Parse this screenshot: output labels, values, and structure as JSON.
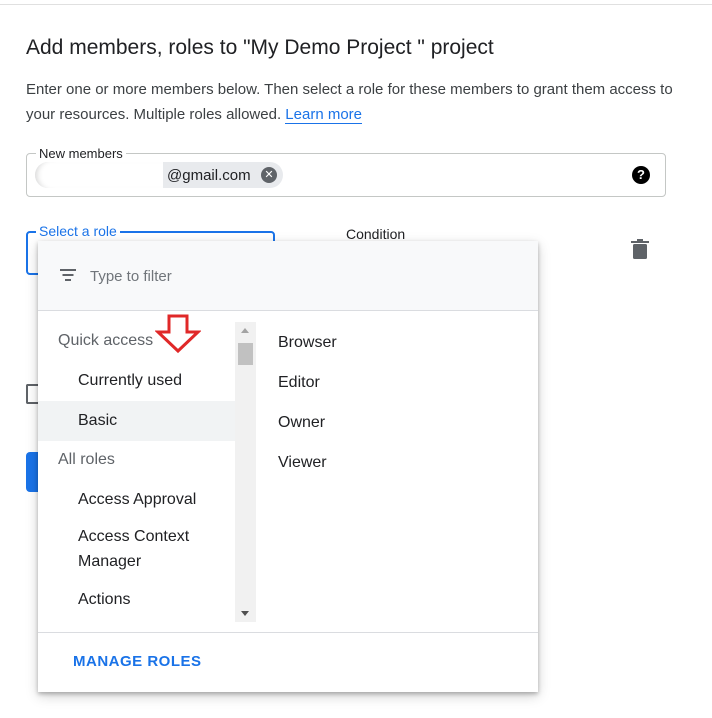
{
  "header": {
    "title": "Add members, roles to \"My Demo Project \" project",
    "description": "Enter one or more members below. Then select a role for these members to grant them access to your resources. Multiple roles allowed.",
    "learn_more": "Learn more"
  },
  "members": {
    "label": "New members",
    "chip_text": "@gmail.com"
  },
  "role": {
    "label": "Select a role"
  },
  "condition": {
    "label": "Condition"
  },
  "dropdown": {
    "filter_placeholder": "Type to filter",
    "left_items": [
      {
        "label": "Quick access",
        "type": "header"
      },
      {
        "label": "Currently used",
        "type": "item"
      },
      {
        "label": "Basic",
        "type": "item",
        "selected": true
      },
      {
        "label": "All roles",
        "type": "header"
      },
      {
        "label": "Access Approval",
        "type": "item"
      },
      {
        "label": "Access Context Manager",
        "type": "item"
      },
      {
        "label": "Actions",
        "type": "item"
      }
    ],
    "right_items": [
      "Browser",
      "Editor",
      "Owner",
      "Viewer"
    ],
    "manage_roles": "MANAGE ROLES"
  },
  "colors": {
    "accent": "#1a73e8",
    "annotation_arrow": "#e02828"
  }
}
